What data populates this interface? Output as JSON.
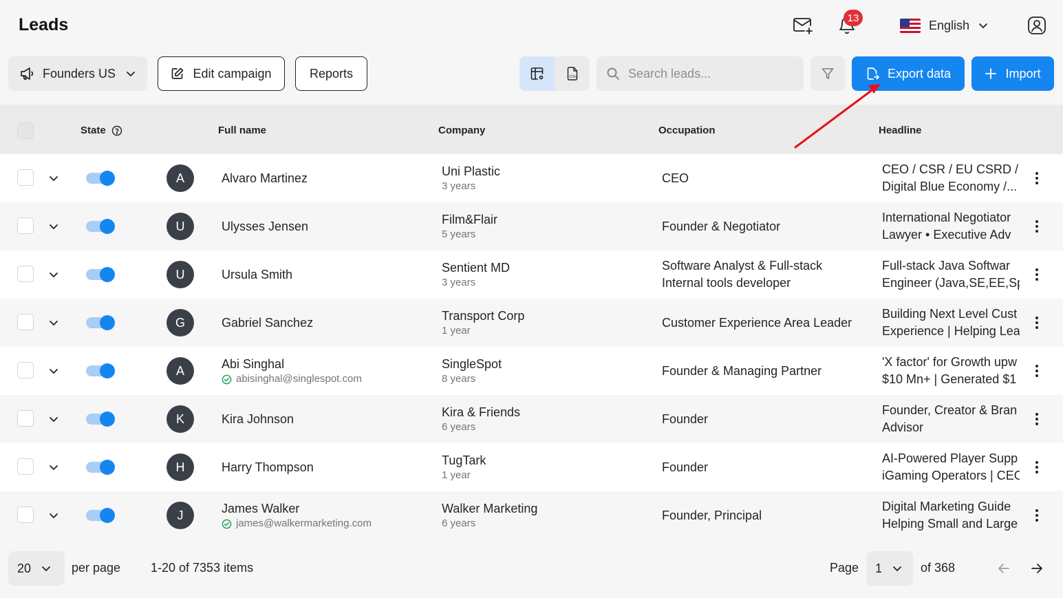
{
  "header": {
    "title": "Leads",
    "notification_count": "13",
    "language": "English"
  },
  "toolbar": {
    "campaign": "Founders US",
    "edit_campaign": "Edit campaign",
    "reports": "Reports",
    "search_placeholder": "Search leads...",
    "export": "Export data",
    "import": "Import"
  },
  "table": {
    "columns": {
      "state": "State",
      "full_name": "Full name",
      "company": "Company",
      "occupation": "Occupation",
      "headline": "Headline"
    },
    "rows": [
      {
        "initial": "A",
        "name": "Alvaro Martinez",
        "email": "",
        "company": "Uni Plastic",
        "tenure": "3 years",
        "occupation": "CEO",
        "headline1": "CEO / CSR / EU CSRD / E",
        "headline2": "Digital Blue Economy /..."
      },
      {
        "initial": "U",
        "name": "Ulysses Jensen",
        "email": "",
        "company": "Film&Flair",
        "tenure": "5 years",
        "occupation": "Founder & Negotiator",
        "headline1": "International Negotiator",
        "headline2": "Lawyer • Executive Adv"
      },
      {
        "initial": "U",
        "name": "Ursula Smith",
        "email": "",
        "company": "Sentient MD",
        "tenure": "3 years",
        "occupation": "Software Analyst & Full-stack Internal tools developer",
        "headline1": "Full-stack Java Softwar",
        "headline2": "Engineer (Java,SE,EE,Sp"
      },
      {
        "initial": "G",
        "name": "Gabriel Sanchez",
        "email": "",
        "company": "Transport Corp",
        "tenure": "1 year",
        "occupation": "Customer Experience Area Leader",
        "headline1": "Building Next Level Cust",
        "headline2": "Experience | Helping Lea"
      },
      {
        "initial": "A",
        "name": "Abi Singhal",
        "email": "abisinghal@singlespot.com",
        "company": "SingleSpot",
        "tenure": "8 years",
        "occupation": "Founder & Managing Partner",
        "headline1": "'X factor' for Growth upw",
        "headline2": "$10 Mn+ | Generated $1"
      },
      {
        "initial": "K",
        "name": "Kira Johnson",
        "email": "",
        "company": "Kira & Friends",
        "tenure": "6 years",
        "occupation": "Founder",
        "headline1": "Founder, Creator & Bran",
        "headline2": "Advisor"
      },
      {
        "initial": "H",
        "name": "Harry Thompson",
        "email": "",
        "company": "TugTark",
        "tenure": "1 year",
        "occupation": "Founder",
        "headline1": "AI-Powered Player Supp",
        "headline2": "iGaming Operators | CEO"
      },
      {
        "initial": "J",
        "name": "James Walker",
        "email": "james@walkermarketing.com",
        "company": "Walker Marketing",
        "tenure": "6 years",
        "occupation": "Founder, Principal",
        "headline1": "Digital Marketing Guide",
        "headline2": "Helping Small and Large"
      }
    ]
  },
  "footer": {
    "per_page_value": "20",
    "per_page_label": "per page",
    "items_range": "1-20 of 7353 items",
    "page_label": "Page",
    "page_value": "1",
    "page_total": "of 368"
  },
  "colors": {
    "accent": "#1585f0",
    "badge": "#e0303a",
    "annotation": "#e8101a"
  }
}
